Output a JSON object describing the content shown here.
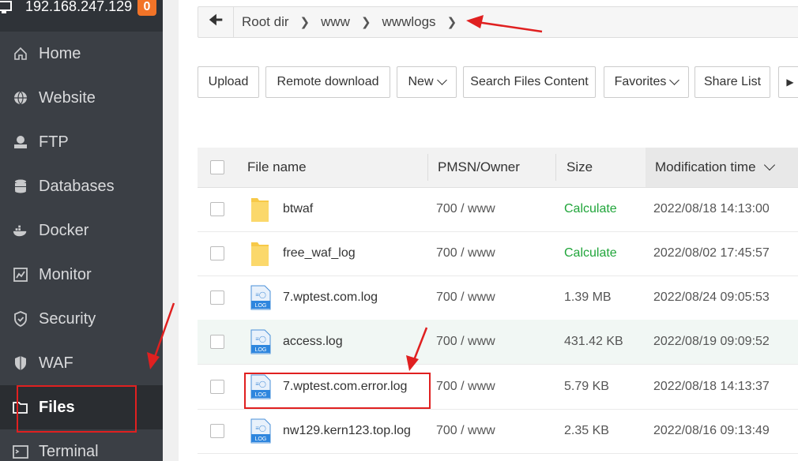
{
  "server": {
    "ip": "192.168.247.129",
    "badge": "0"
  },
  "nav": [
    {
      "label": "Home",
      "icon": "home-icon"
    },
    {
      "label": "Website",
      "icon": "globe-icon"
    },
    {
      "label": "FTP",
      "icon": "ftp-icon"
    },
    {
      "label": "Databases",
      "icon": "database-icon"
    },
    {
      "label": "Docker",
      "icon": "docker-icon"
    },
    {
      "label": "Monitor",
      "icon": "monitor-icon"
    },
    {
      "label": "Security",
      "icon": "shield-icon"
    },
    {
      "label": "WAF",
      "icon": "waf-shield-icon"
    },
    {
      "label": "Files",
      "icon": "folder-icon",
      "active": true
    },
    {
      "label": "Terminal",
      "icon": "terminal-icon"
    }
  ],
  "breadcrumb": {
    "items": [
      "Root dir",
      "www",
      "wwwlogs"
    ]
  },
  "toolbar": {
    "upload": "Upload",
    "remote_download": "Remote download",
    "new": "New",
    "search_files_content": "Search Files Content",
    "favorites": "Favorites",
    "share_list": "Share List"
  },
  "table": {
    "headers": {
      "file_name": "File name",
      "pmsn_owner": "PMSN/Owner",
      "size": "Size",
      "modification_time": "Modification time"
    },
    "rows": [
      {
        "name": "btwaf",
        "type": "folder",
        "perm": "700 / www",
        "size": "Calculate",
        "mtime": "2022/08/18 14:13:00"
      },
      {
        "name": "free_waf_log",
        "type": "folder",
        "perm": "700 / www",
        "size": "Calculate",
        "mtime": "2022/08/02 17:45:57"
      },
      {
        "name": "7.wptest.com.log",
        "type": "log",
        "perm": "700 / www",
        "size": "1.39 MB",
        "mtime": "2022/08/24 09:05:53"
      },
      {
        "name": "access.log",
        "type": "log",
        "perm": "700 / www",
        "size": "431.42 KB",
        "mtime": "2022/08/19 09:09:52"
      },
      {
        "name": "7.wptest.com.error.log",
        "type": "log",
        "perm": "700 / www",
        "size": "5.79 KB",
        "mtime": "2022/08/18 14:13:37"
      },
      {
        "name": "nw129.kern123.top.log",
        "type": "log",
        "perm": "700 / www",
        "size": "2.35 KB",
        "mtime": "2022/08/16 09:13:49"
      }
    ]
  },
  "colors": {
    "sidebar": "#3b3f45",
    "accent_green": "#20a53a",
    "annotation_red": "#e02020",
    "badge": "#f27428"
  }
}
